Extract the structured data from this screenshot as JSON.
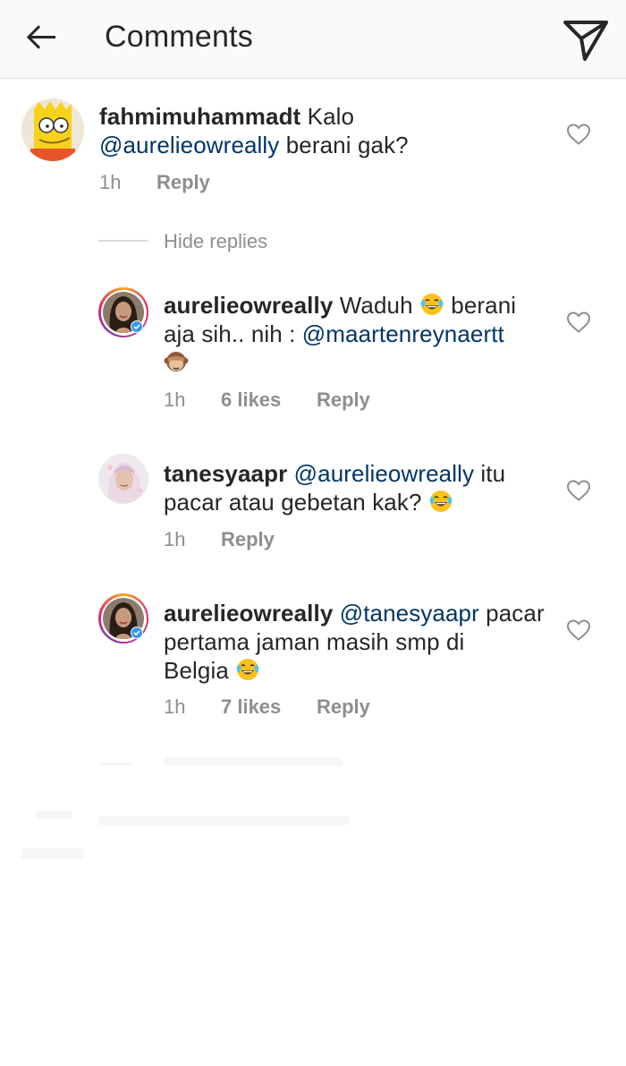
{
  "header": {
    "title": "Comments",
    "back_icon": "arrow-left-icon",
    "send_icon": "paper-plane-icon"
  },
  "colors": {
    "mention": "#003569",
    "meta": "#8e8e8e",
    "text": "#262626",
    "header_bg": "#fafafa"
  },
  "comments": [
    {
      "username": "fahmimuhammadt",
      "line1_text": " Kalo",
      "line2_mention": "@aurelieowreally",
      "line2_text": " berani gak?",
      "time": "1h",
      "reply": "Reply"
    }
  ],
  "hide_replies": "Hide replies",
  "replies": [
    {
      "username": "aurelieowreally",
      "line1_a": " Waduh ",
      "line1_b": " berani",
      "line2_text": "aja sih.. nih : ",
      "line2_mention": "@maartenreynaertt",
      "line3_emoji": "see-no-evil-monkey-emoji",
      "time": "1h",
      "likes": "6 likes",
      "reply": "Reply"
    },
    {
      "username": "tanesyaapr",
      "line1_mention": "@aurelieowreally",
      "line1_text": " itu",
      "line2_text": "pacar atau gebetan kak? ",
      "time": "1h",
      "reply": "Reply"
    },
    {
      "username": "aurelieowreally",
      "line1_mention": "@tanesyaapr",
      "line1_text": " pacar",
      "line2_text": "pertama jaman masih smp di",
      "line3_text": "Belgia ",
      "time": "1h",
      "likes": "7 likes",
      "reply": "Reply"
    }
  ]
}
